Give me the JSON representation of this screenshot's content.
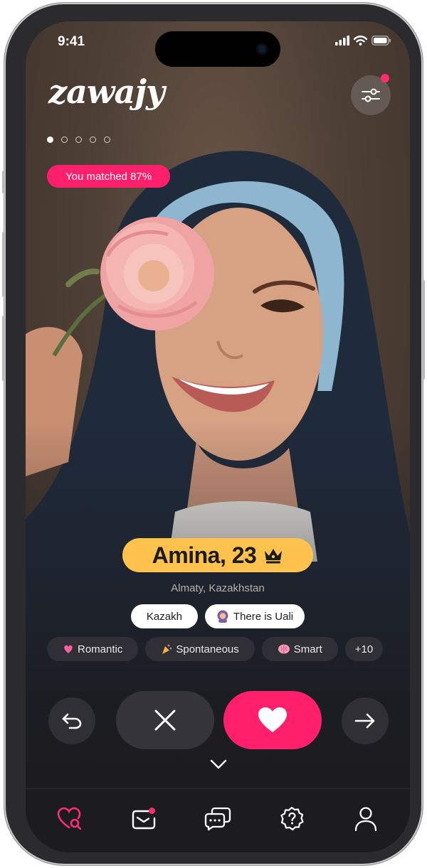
{
  "status_bar": {
    "time": "9:41"
  },
  "header": {
    "logo": "zawajy"
  },
  "profile": {
    "match_label": "You matched 87%",
    "match_percent": 87,
    "name_age": "Amina, 23",
    "location": "Almaty, Kazakhstan",
    "tags": [
      {
        "label": "Kazakh",
        "icon": ""
      },
      {
        "label": "There is Uali",
        "icon": "person-hijab-emoji"
      }
    ],
    "traits": [
      {
        "label": "Romantic",
        "icon": "love-letter-emoji"
      },
      {
        "label": "Spontaneous",
        "icon": "party-popper-emoji"
      },
      {
        "label": "Smart",
        "icon": "brain-emoji"
      }
    ],
    "more_traits": "+10"
  },
  "pager": {
    "count": 5,
    "active_index": 0
  },
  "tabs": [
    {
      "name": "discover",
      "icon": "heart-search-icon",
      "active": true
    },
    {
      "name": "messages",
      "icon": "mail-icon",
      "badge": true
    },
    {
      "name": "chats",
      "icon": "chat-icon"
    },
    {
      "name": "help",
      "icon": "question-badge-icon"
    },
    {
      "name": "profile",
      "icon": "user-icon"
    }
  ],
  "colors": {
    "accent": "#ff1f6b",
    "name_pill": "#ffc24d",
    "surface": "#1c1c20",
    "chip": "#2f2f35"
  }
}
